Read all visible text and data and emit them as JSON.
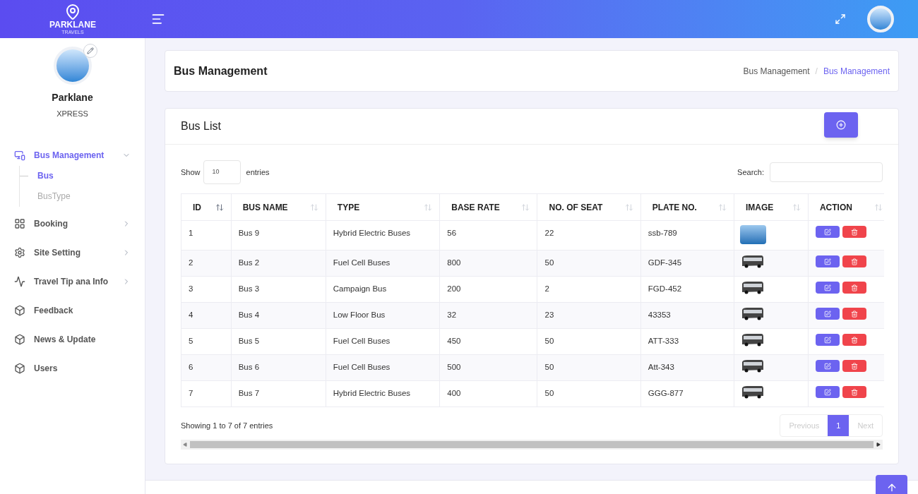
{
  "topbar": {
    "logo_text": "PARKLANE",
    "logo_subtext": "TRAVELS"
  },
  "profile": {
    "name": "Parklane",
    "subtitle": "XPRESS"
  },
  "sidebar": {
    "items": [
      {
        "label": "Bus Management",
        "selected": true,
        "expanded": true,
        "children": [
          {
            "label": "Bus",
            "selected": true
          },
          {
            "label": "BusType",
            "selected": false
          }
        ]
      },
      {
        "label": "Booking",
        "selected": false,
        "expanded": false
      },
      {
        "label": "Site Setting",
        "selected": false,
        "expanded": false
      },
      {
        "label": "Travel Tip ana Info",
        "selected": false,
        "expanded": false
      },
      {
        "label": "Feedback",
        "selected": false
      },
      {
        "label": "News & Update",
        "selected": false
      },
      {
        "label": "Users",
        "selected": false
      }
    ]
  },
  "page_header": {
    "title": "Bus Management",
    "separator": "/",
    "breadcrumb": [
      {
        "label": "Bus Management",
        "selected": false
      },
      {
        "label": "Bus Management",
        "selected": true
      }
    ]
  },
  "card": {
    "title": "Bus List"
  },
  "length_control": {
    "before": "Show",
    "value": "10",
    "after": "entries"
  },
  "search": {
    "label": "Search:"
  },
  "table": {
    "columns": [
      "ID",
      "BUS NAME",
      "TYPE",
      "BASE RATE",
      "NO. OF SEAT",
      "PLATE NO.",
      "IMAGE",
      "ACTION"
    ],
    "rows": [
      {
        "cells": [
          "1",
          "Bus 9",
          "Hybrid Electric Buses",
          "56",
          "22",
          "ssb-789"
        ],
        "kind": "photo"
      },
      {
        "cells": [
          "2",
          "Bus 2",
          "Fuel Cell Buses",
          "800",
          "50",
          "GDF-345"
        ],
        "kind": "drawing"
      },
      {
        "cells": [
          "3",
          "Bus 3",
          "Campaign Bus",
          "200",
          "2",
          "FGD-452"
        ],
        "kind": "drawing"
      },
      {
        "cells": [
          "4",
          "Bus 4",
          "Low Floor Bus",
          "32",
          "23",
          "43353"
        ],
        "kind": "drawing"
      },
      {
        "cells": [
          "5",
          "Bus 5",
          "Fuel Cell Buses",
          "450",
          "50",
          "ATT-333"
        ],
        "kind": "drawing"
      },
      {
        "cells": [
          "6",
          "Bus 6",
          "Fuel Cell Buses",
          "500",
          "50",
          "Att-343"
        ],
        "kind": "drawing"
      },
      {
        "cells": [
          "7",
          "Bus 7",
          "Hybrid Electric Buses",
          "400",
          "50",
          "GGG-877"
        ],
        "kind": "drawing"
      }
    ]
  },
  "info": "Showing 1 to 7 of 7 entries",
  "pagination": [
    {
      "label": "Previous",
      "kind": "nav",
      "disabled": true
    },
    {
      "label": "1",
      "kind": "page",
      "selected": true
    },
    {
      "label": "Next",
      "kind": "nav",
      "disabled": true
    }
  ]
}
